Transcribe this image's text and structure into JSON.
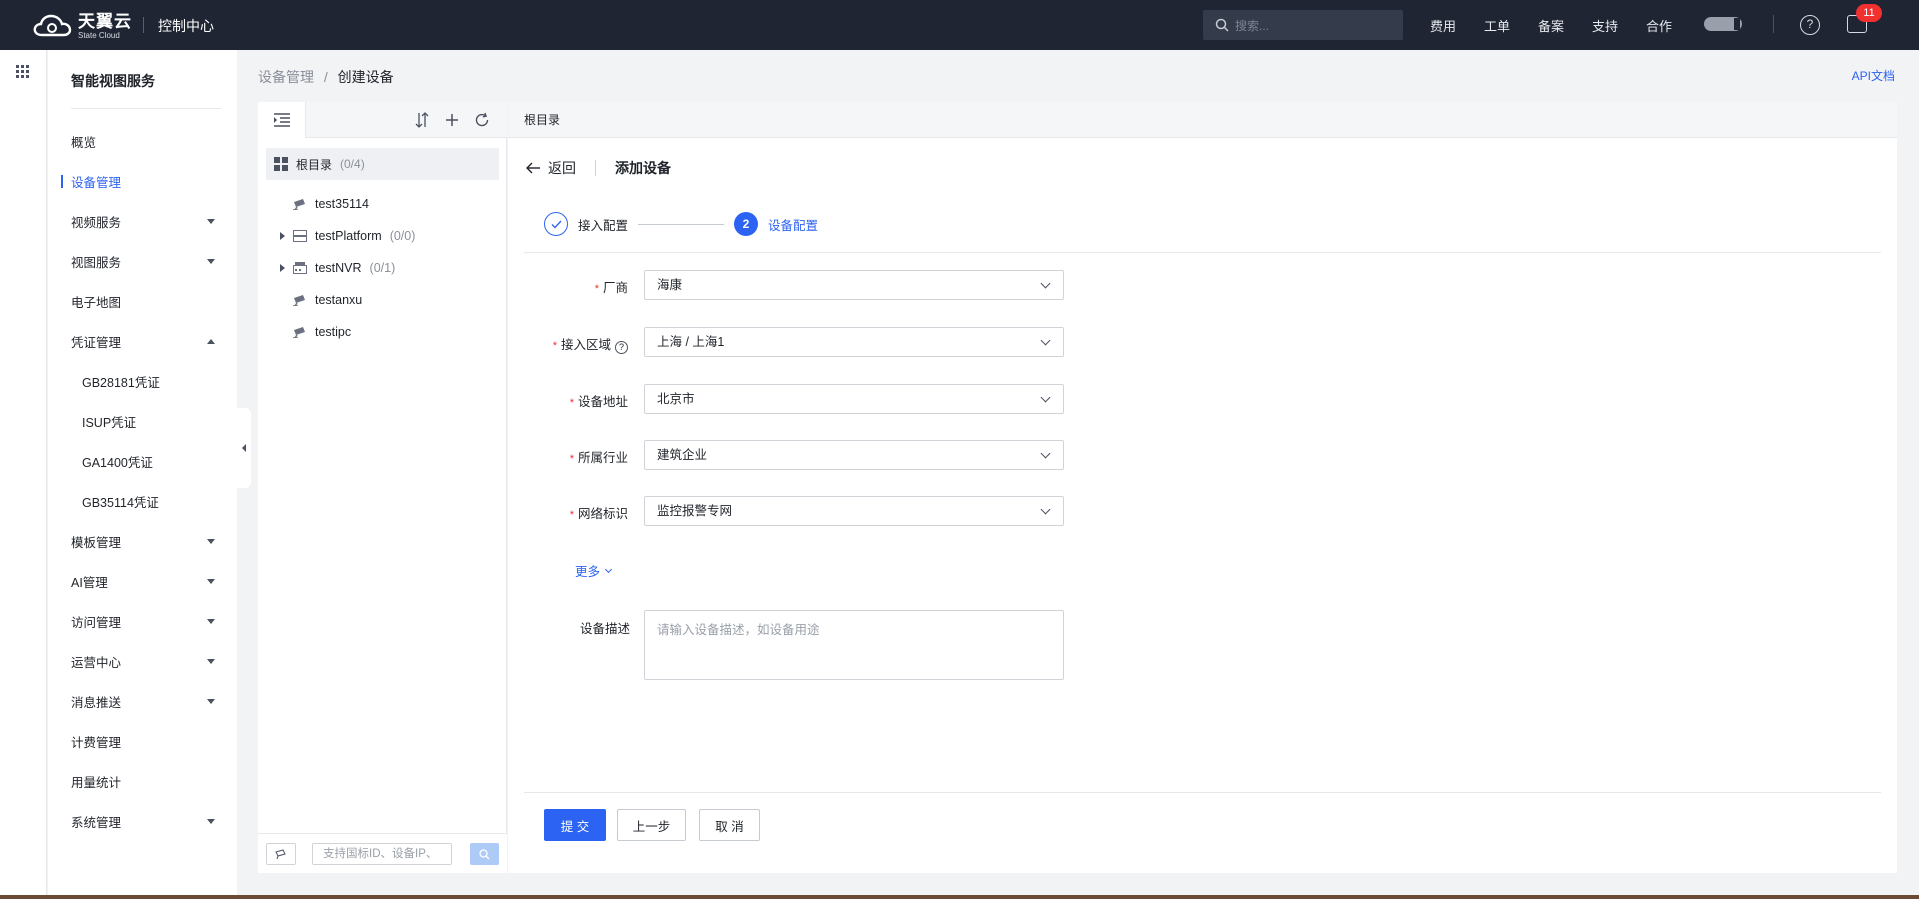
{
  "topbar": {
    "logo_cn": "天翼云",
    "logo_en": "State Cloud",
    "console": "控制中心",
    "search_placeholder": "搜索...",
    "nav": [
      "费用",
      "工单",
      "备案",
      "支持",
      "合作"
    ],
    "message_count": "11"
  },
  "sidebar": {
    "title": "智能视图服务",
    "items": [
      {
        "label": "概览"
      },
      {
        "label": "设备管理",
        "active": true
      },
      {
        "label": "视频服务"
      },
      {
        "label": "视图服务"
      },
      {
        "label": "电子地图"
      },
      {
        "label": "凭证管理"
      },
      {
        "label": "GB28181凭证"
      },
      {
        "label": "ISUP凭证"
      },
      {
        "label": "GA1400凭证"
      },
      {
        "label": "GB35114凭证"
      },
      {
        "label": "模板管理"
      },
      {
        "label": "AI管理"
      },
      {
        "label": "访问管理"
      },
      {
        "label": "运营中心"
      },
      {
        "label": "消息推送"
      },
      {
        "label": "计费管理"
      },
      {
        "label": "用量统计"
      },
      {
        "label": "系统管理"
      }
    ]
  },
  "breadcrumb": {
    "parent": "设备管理",
    "separator": "/",
    "current": "创建设备"
  },
  "api_doc": "API文档",
  "tree": {
    "root": {
      "label": "根目录",
      "count": "(0/4)"
    },
    "nodes": [
      {
        "label": "test35114",
        "count": ""
      },
      {
        "label": "testPlatform",
        "count": "(0/0)"
      },
      {
        "label": "testNVR",
        "count": "(0/1)"
      },
      {
        "label": "testanxu",
        "count": ""
      },
      {
        "label": "testipc",
        "count": ""
      }
    ],
    "search_placeholder": "支持国标ID、设备IP、"
  },
  "main": {
    "header": "根目录",
    "back": "返回",
    "title": "添加设备",
    "steps": [
      {
        "number": "",
        "label": "接入配置",
        "status": "done"
      },
      {
        "number": "2",
        "label": "设备配置",
        "status": "active"
      }
    ],
    "form": {
      "vendor": {
        "label": "厂商",
        "value": "海康"
      },
      "region": {
        "label": "接入区域",
        "value": "上海 / 上海1"
      },
      "address": {
        "label": "设备地址",
        "value": "北京市"
      },
      "industry": {
        "label": "所属行业",
        "value": "建筑企业"
      },
      "network": {
        "label": "网络标识",
        "value": "监控报警专网"
      },
      "more": "更多",
      "desc": {
        "label": "设备描述",
        "placeholder": "请输入设备描述，如设备用途"
      }
    },
    "buttons": {
      "submit": "提 交",
      "prev": "上一步",
      "cancel": "取 消"
    }
  }
}
